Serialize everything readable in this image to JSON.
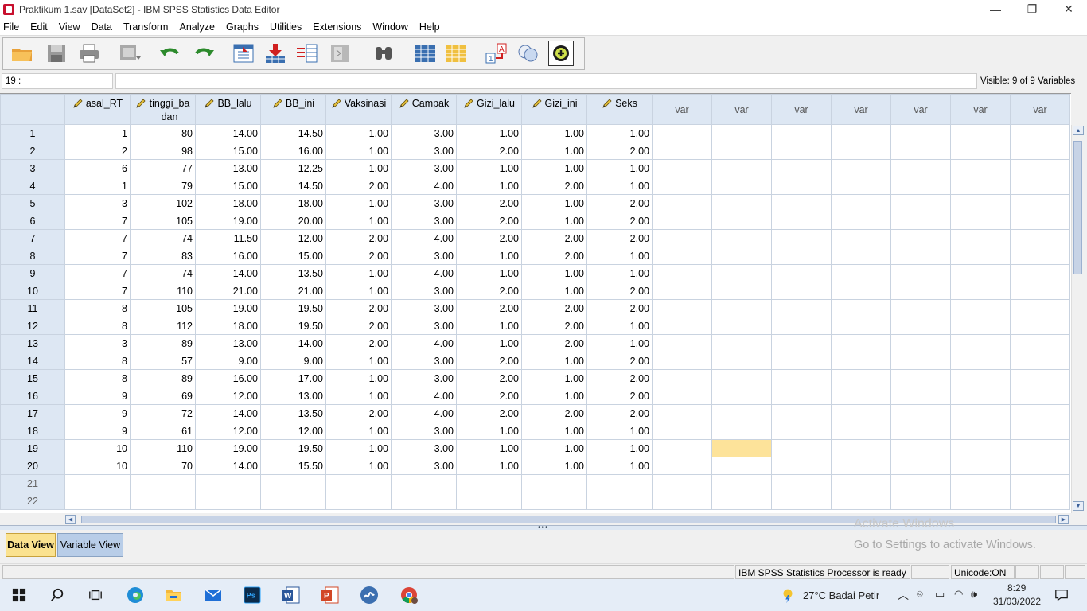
{
  "window": {
    "title": "Praktikum 1.sav [DataSet2] - IBM SPSS Statistics Data Editor",
    "minimize": "—",
    "restore": "❐",
    "close": "✕"
  },
  "menu": [
    "File",
    "Edit",
    "View",
    "Data",
    "Transform",
    "Analyze",
    "Graphs",
    "Utilities",
    "Extensions",
    "Window",
    "Help"
  ],
  "toolbar": {
    "icons": [
      "open-folder-icon",
      "save-icon",
      "print-icon",
      "recall-dialog-icon",
      "undo-icon",
      "redo-icon",
      "goto-case-icon",
      "goto-variable-icon",
      "variables-icon",
      "select-cases-icon",
      "find-icon",
      "insert-cases-icon",
      "insert-variable-icon",
      "value-labels-icon",
      "use-sets-icon",
      "spelling-icon"
    ]
  },
  "cell_editor": {
    "reference": "19 :",
    "value": "",
    "visible_variables": "Visible: 9 of 9 Variables"
  },
  "grid": {
    "columns": [
      "asal_RT",
      "tinggi_badan",
      "BB_lalu",
      "BB_ini",
      "Vaksinasi",
      "Campak",
      "Gizi_lalu",
      "Gizi_ini",
      "Seks"
    ],
    "column_display": [
      "asal_RT",
      "tinggi_ba dan",
      "BB_lalu",
      "BB_ini",
      "Vaksinasi",
      "Campak",
      "Gizi_lalu",
      "Gizi_ini",
      "Seks"
    ],
    "empty_var_label": "var",
    "empty_var_count": 7,
    "rows": [
      [
        "1",
        "80",
        "14.00",
        "14.50",
        "1.00",
        "3.00",
        "1.00",
        "1.00",
        "1.00"
      ],
      [
        "2",
        "98",
        "15.00",
        "16.00",
        "1.00",
        "3.00",
        "2.00",
        "1.00",
        "2.00"
      ],
      [
        "6",
        "77",
        "13.00",
        "12.25",
        "1.00",
        "3.00",
        "1.00",
        "1.00",
        "1.00"
      ],
      [
        "1",
        "79",
        "15.00",
        "14.50",
        "2.00",
        "4.00",
        "1.00",
        "2.00",
        "1.00"
      ],
      [
        "3",
        "102",
        "18.00",
        "18.00",
        "1.00",
        "3.00",
        "2.00",
        "1.00",
        "2.00"
      ],
      [
        "7",
        "105",
        "19.00",
        "20.00",
        "1.00",
        "3.00",
        "2.00",
        "1.00",
        "2.00"
      ],
      [
        "7",
        "74",
        "11.50",
        "12.00",
        "2.00",
        "4.00",
        "2.00",
        "2.00",
        "2.00"
      ],
      [
        "7",
        "83",
        "16.00",
        "15.00",
        "2.00",
        "3.00",
        "1.00",
        "2.00",
        "1.00"
      ],
      [
        "7",
        "74",
        "14.00",
        "13.50",
        "1.00",
        "4.00",
        "1.00",
        "1.00",
        "1.00"
      ],
      [
        "7",
        "110",
        "21.00",
        "21.00",
        "1.00",
        "3.00",
        "2.00",
        "1.00",
        "2.00"
      ],
      [
        "8",
        "105",
        "19.00",
        "19.50",
        "2.00",
        "3.00",
        "2.00",
        "2.00",
        "2.00"
      ],
      [
        "8",
        "112",
        "18.00",
        "19.50",
        "2.00",
        "3.00",
        "1.00",
        "2.00",
        "1.00"
      ],
      [
        "3",
        "89",
        "13.00",
        "14.00",
        "2.00",
        "4.00",
        "1.00",
        "2.00",
        "1.00"
      ],
      [
        "8",
        "57",
        "9.00",
        "9.00",
        "1.00",
        "3.00",
        "2.00",
        "1.00",
        "2.00"
      ],
      [
        "8",
        "89",
        "16.00",
        "17.00",
        "1.00",
        "3.00",
        "2.00",
        "1.00",
        "2.00"
      ],
      [
        "9",
        "69",
        "12.00",
        "13.00",
        "1.00",
        "4.00",
        "2.00",
        "1.00",
        "2.00"
      ],
      [
        "9",
        "72",
        "14.00",
        "13.50",
        "2.00",
        "4.00",
        "2.00",
        "2.00",
        "2.00"
      ],
      [
        "9",
        "61",
        "12.00",
        "12.00",
        "1.00",
        "3.00",
        "1.00",
        "1.00",
        "1.00"
      ],
      [
        "10",
        "110",
        "19.00",
        "19.50",
        "1.00",
        "3.00",
        "1.00",
        "1.00",
        "1.00"
      ],
      [
        "10",
        "70",
        "14.00",
        "15.50",
        "1.00",
        "3.00",
        "1.00",
        "1.00",
        "1.00"
      ]
    ],
    "empty_row_numbers": [
      "21",
      "22"
    ],
    "selected_cell": {
      "row": 19,
      "column": "var 2"
    }
  },
  "view_tabs": {
    "data_view": "Data View",
    "variable_view": "Variable View"
  },
  "watermark": {
    "line1": "Activate Windows",
    "line2": "Go to Settings to activate Windows."
  },
  "status": {
    "processor": "IBM SPSS Statistics Processor is ready",
    "unicode": "Unicode:ON"
  },
  "taskbar": {
    "weather": "27°C  Badai Petir",
    "time": "8:29",
    "date": "31/03/2022",
    "apps": [
      "start-icon",
      "search-icon",
      "task-view-icon",
      "edge-icon",
      "file-explorer-icon",
      "mail-icon",
      "photoshop-icon",
      "word-icon",
      "powerpoint-icon",
      "spss-icon",
      "chrome-icon"
    ]
  },
  "colors": {
    "header_bg": "#dde7f3",
    "selected_cell": "#fde39a",
    "active_tab": "#fbe28f",
    "inactive_tab": "#b8cde8"
  }
}
